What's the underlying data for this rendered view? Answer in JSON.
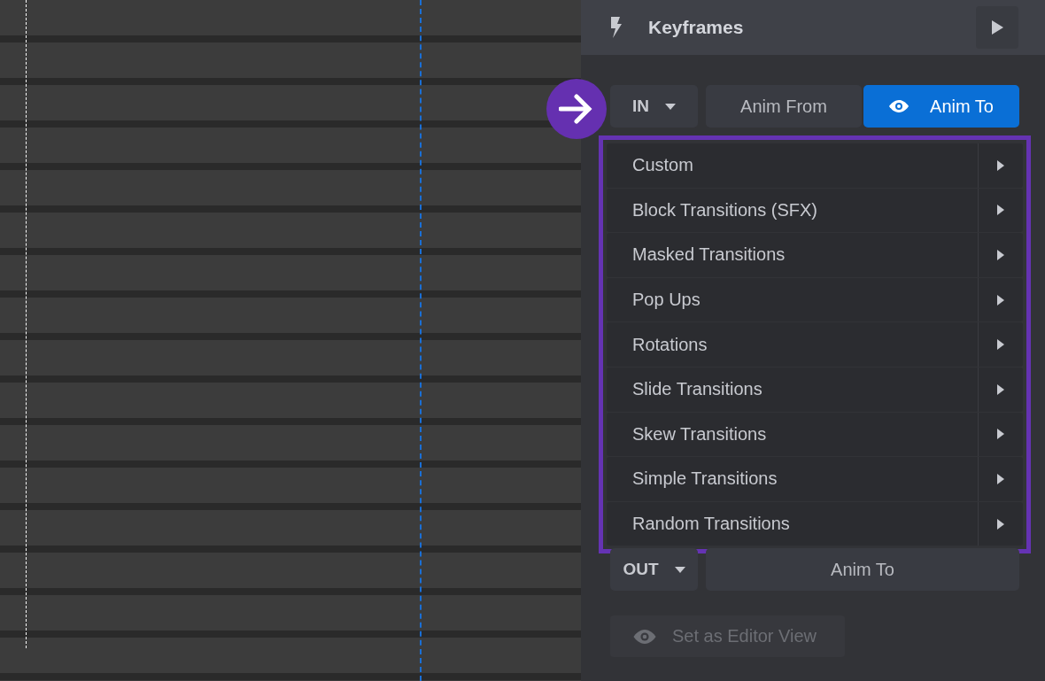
{
  "panel": {
    "title": "Keyframes"
  },
  "in_row": {
    "direction": "IN",
    "options": [
      {
        "label": "Anim From",
        "selected": false
      },
      {
        "label": "Anim To",
        "selected": true
      }
    ]
  },
  "presets": [
    {
      "label": "Custom"
    },
    {
      "label": "Block Transitions (SFX)"
    },
    {
      "label": "Masked Transitions"
    },
    {
      "label": "Pop Ups"
    },
    {
      "label": "Rotations"
    },
    {
      "label": "Slide Transitions"
    },
    {
      "label": "Skew Transitions"
    },
    {
      "label": "Simple Transitions"
    },
    {
      "label": "Random Transitions"
    }
  ],
  "out_row": {
    "direction": "OUT",
    "options": [
      {
        "label": "Anim To",
        "selected": false
      }
    ]
  },
  "editor_view_button": {
    "label": "Set as Editor View",
    "disabled": true
  }
}
